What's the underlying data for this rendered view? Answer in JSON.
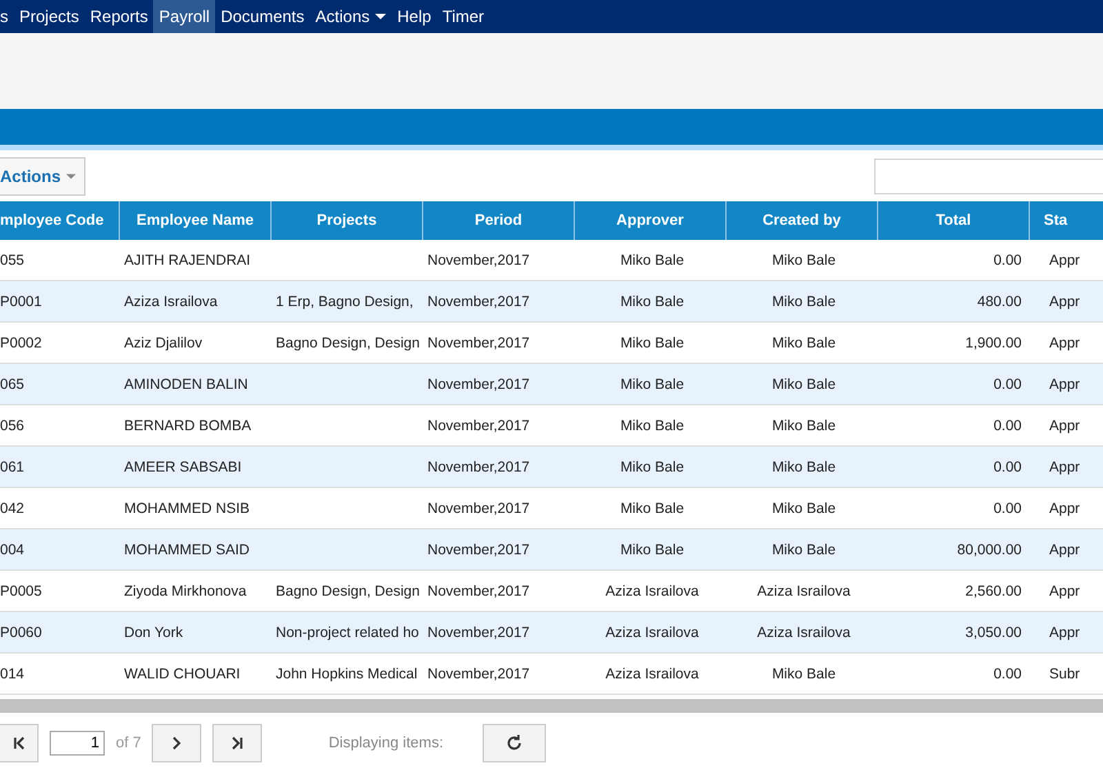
{
  "nav": [
    {
      "label": "s",
      "selected": false,
      "dropdown": false
    },
    {
      "label": "Projects",
      "selected": false,
      "dropdown": false
    },
    {
      "label": "Reports",
      "selected": false,
      "dropdown": false
    },
    {
      "label": "Payroll",
      "selected": true,
      "dropdown": false
    },
    {
      "label": "Documents",
      "selected": false,
      "dropdown": false
    },
    {
      "label": "Actions",
      "selected": false,
      "dropdown": true
    },
    {
      "label": "Help",
      "selected": false,
      "dropdown": false
    },
    {
      "label": "Timer",
      "selected": false,
      "dropdown": false
    }
  ],
  "toolbar": {
    "actions_button": "Actions"
  },
  "table": {
    "columns": [
      {
        "label": "mployee Code"
      },
      {
        "label": "Employee Name"
      },
      {
        "label": "Projects"
      },
      {
        "label": "Period"
      },
      {
        "label": "Approver"
      },
      {
        "label": "Created by"
      },
      {
        "label": "Total"
      },
      {
        "label": "Sta"
      }
    ],
    "rows": [
      [
        "055",
        "AJITH RAJENDRAI",
        "",
        "November,2017",
        "Miko Bale",
        "Miko Bale",
        "0.00",
        "Appr"
      ],
      [
        "P0001",
        "Aziza Israilova",
        "1 Erp, Bagno Design,",
        "November,2017",
        "Miko Bale",
        "Miko Bale",
        "480.00",
        "Appr"
      ],
      [
        "P0002",
        "Aziz Djalilov",
        "Bagno Design, Design",
        "November,2017",
        "Miko Bale",
        "Miko Bale",
        "1,900.00",
        "Appr"
      ],
      [
        "065",
        "AMINODEN BALIN",
        "",
        "November,2017",
        "Miko Bale",
        "Miko Bale",
        "0.00",
        "Appr"
      ],
      [
        "056",
        "BERNARD BOMBA",
        "",
        "November,2017",
        "Miko Bale",
        "Miko Bale",
        "0.00",
        "Appr"
      ],
      [
        "061",
        "AMEER SABSABI",
        "",
        "November,2017",
        "Miko Bale",
        "Miko Bale",
        "0.00",
        "Appr"
      ],
      [
        "042",
        "MOHAMMED NSIB",
        "",
        "November,2017",
        "Miko Bale",
        "Miko Bale",
        "0.00",
        "Appr"
      ],
      [
        "004",
        "MOHAMMED SAID",
        "",
        "November,2017",
        "Miko Bale",
        "Miko Bale",
        "80,000.00",
        "Appr"
      ],
      [
        "P0005",
        "Ziyoda Mirkhonova",
        "Bagno Design, Design",
        "November,2017",
        "Aziza Israilova",
        "Aziza Israilova",
        "2,560.00",
        "Appr"
      ],
      [
        "P0060",
        "Don York",
        "Non-project related ho",
        "November,2017",
        "Aziza Israilova",
        "Aziza Israilova",
        "3,050.00",
        "Appr"
      ],
      [
        "014",
        "WALID CHOUARI",
        "John Hopkins Medical",
        "November,2017",
        "Aziza Israilova",
        "Miko Bale",
        "0.00",
        "Subr"
      ]
    ]
  },
  "pager": {
    "page": "1",
    "of": "of 7",
    "displaying": "Displaying items:"
  }
}
